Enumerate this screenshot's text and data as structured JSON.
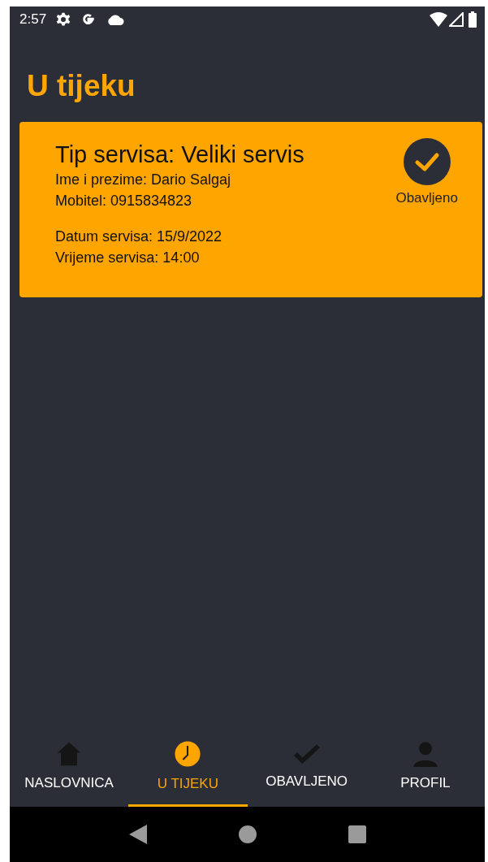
{
  "status_bar": {
    "time": "2:57"
  },
  "title": "U tijeku",
  "cards": [
    {
      "service_type": "Tip servisa: Veliki servis",
      "name": "Ime i prezime: Dario Salgaj",
      "phone": "Mobitel: 0915834823",
      "date": "Datum servisa: 15/9/2022",
      "time": "Vrijeme servisa: 14:00",
      "action": "Obavljeno"
    }
  ],
  "tabs": [
    {
      "label": "NASLOVNICA",
      "kind": "home",
      "selected": false
    },
    {
      "label": "U TIJEKU",
      "kind": "clock",
      "selected": true
    },
    {
      "label": "OBAVLJENO",
      "kind": "check",
      "selected": false
    },
    {
      "label": "PROFIL",
      "kind": "person",
      "selected": false
    }
  ]
}
